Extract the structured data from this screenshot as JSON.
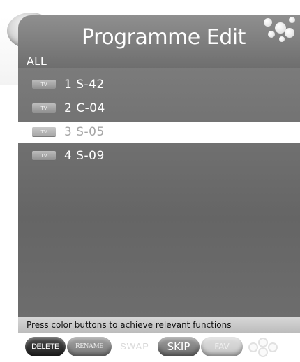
{
  "header": {
    "title": "Programme Edit"
  },
  "list": {
    "group_label": "ALL",
    "badge_label": "TV",
    "items": [
      {
        "number": "1",
        "name": "S-42",
        "label": "1 S-42"
      },
      {
        "number": "2",
        "name": "C-04",
        "label": "2 C-04"
      },
      {
        "number": "3",
        "name": "S-05",
        "label": "3 S-05",
        "selected": true
      },
      {
        "number": "4",
        "name": "S-09",
        "label": "4 S-09"
      }
    ]
  },
  "hint": {
    "text": "Press color buttons to achieve relevant functions"
  },
  "buttons": {
    "delete": "DELETE",
    "rename": "RENAME",
    "swap": "SWAP",
    "skip": "SKIP",
    "fav": "FAV"
  }
}
